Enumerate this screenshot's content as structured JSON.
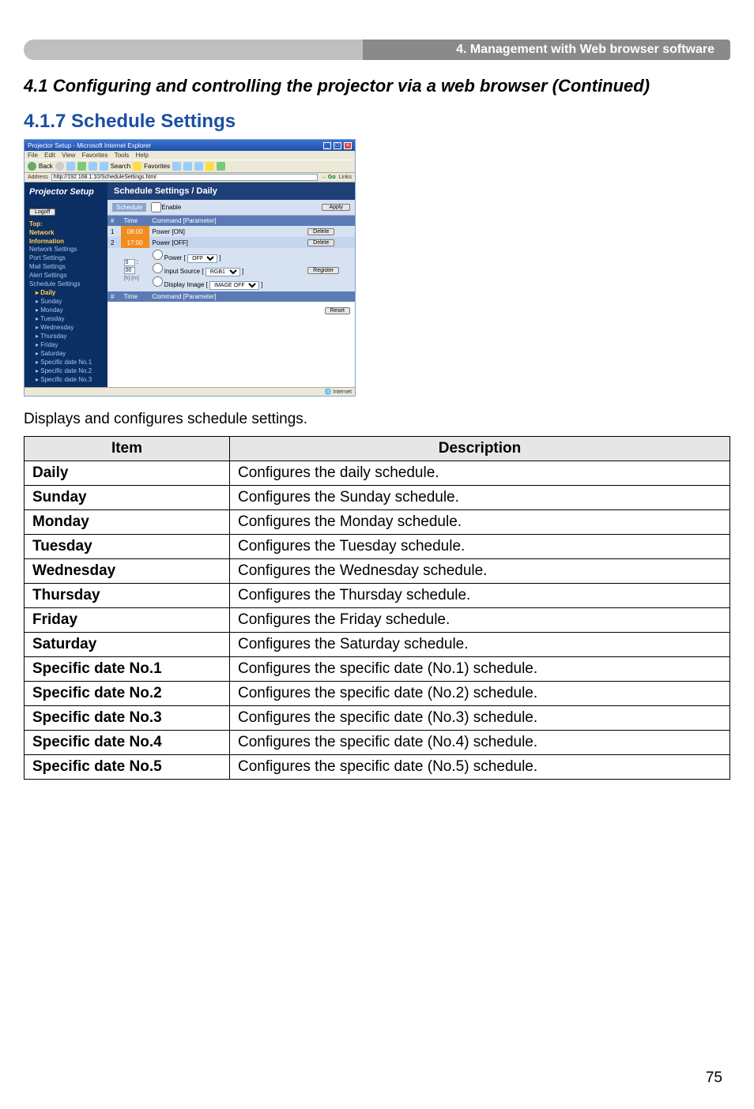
{
  "header_bar": "4. Management with Web browser software",
  "section_title": "4.1 Configuring and controlling the projector via a web browser (Continued)",
  "subsection_title": "4.1.7 Schedule Settings",
  "body_text": "Displays and configures schedule settings.",
  "table": {
    "headers": {
      "item": "Item",
      "desc": "Description"
    },
    "rows": [
      {
        "item": "Daily",
        "desc": "Configures the daily schedule."
      },
      {
        "item": "Sunday",
        "desc": "Configures the Sunday schedule."
      },
      {
        "item": "Monday",
        "desc": "Configures the Monday schedule."
      },
      {
        "item": "Tuesday",
        "desc": "Configures the Tuesday schedule."
      },
      {
        "item": "Wednesday",
        "desc": "Configures the Wednesday schedule."
      },
      {
        "item": "Thursday",
        "desc": "Configures the Thursday schedule."
      },
      {
        "item": "Friday",
        "desc": "Configures the Friday schedule."
      },
      {
        "item": "Saturday",
        "desc": "Configures the Saturday schedule."
      },
      {
        "item": "Specific date No.1",
        "desc": "Configures the specific date (No.1) schedule."
      },
      {
        "item": "Specific date No.2",
        "desc": "Configures the specific date (No.2) schedule."
      },
      {
        "item": "Specific date No.3",
        "desc": "Configures the specific date (No.3) schedule."
      },
      {
        "item": "Specific date No.4",
        "desc": "Configures the specific date (No.4) schedule."
      },
      {
        "item": "Specific date No.5",
        "desc": "Configures the specific date (No.5) schedule."
      }
    ]
  },
  "page_number": "75",
  "screenshot": {
    "window_title": "Projector Setup - Microsoft Internet Explorer",
    "menu": [
      "File",
      "Edit",
      "View",
      "Favorites",
      "Tools",
      "Help"
    ],
    "toolbar": {
      "back": "Back",
      "search": "Search",
      "favorites": "Favorites"
    },
    "address_label": "Address",
    "address_url": "http://192.168.1.10/ScheduleSettings.html",
    "go_label": "Go",
    "links_label": "Links",
    "brand": "Projector Setup",
    "logoff": "Logoff",
    "nav_headers": {
      "top": "Top:",
      "network": "Network",
      "information": "Information"
    },
    "nav_items": [
      "Network Settings",
      "Port Settings",
      "Mail Settings",
      "Alert Settings",
      "Schedule Settings"
    ],
    "nav_sub": [
      "Daily",
      "Sunday",
      "Monday",
      "Tuesday",
      "Wednesday",
      "Thursday",
      "Friday",
      "Saturday",
      "Specific date No.1",
      "Specific date No.2",
      "Specific date No.3"
    ],
    "panel_title": "Schedule Settings / Daily",
    "schedule_label": "Schedule",
    "enable_label": "Enable",
    "apply_btn": "Apply",
    "thead": {
      "num": "#",
      "time": "Time",
      "cmd": "Command [Parameter]"
    },
    "rows": [
      {
        "n": "1",
        "time": "08:00",
        "cmd": "Power [ON]",
        "btn": "Delete"
      },
      {
        "n": "2",
        "time": "17:00",
        "cmd": "Power [OFF]",
        "btn": "Delete"
      }
    ],
    "inputrow": {
      "time_h": "0",
      "time_m": "00",
      "opts": {
        "power_label": "Power",
        "power_val": "OFF",
        "input_label": "Input Source",
        "input_val": "RGB1",
        "img_label": "Display Image",
        "img_val": "IMAGE OFF"
      },
      "btn": "Register"
    },
    "reset_btn": "Reset",
    "status": "Internet"
  }
}
